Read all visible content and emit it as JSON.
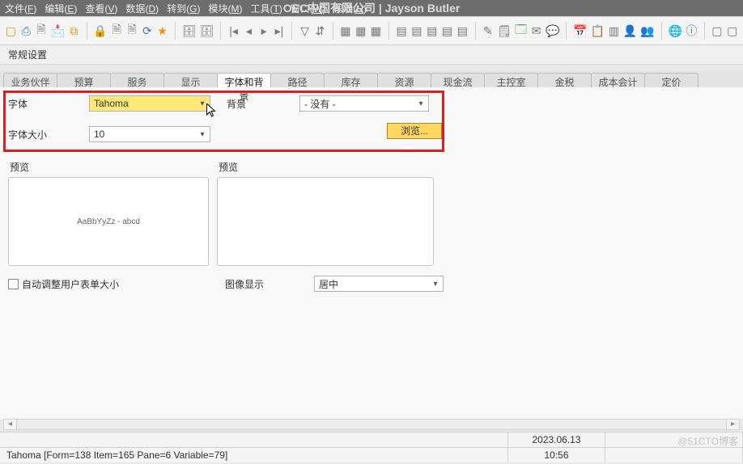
{
  "menubar": {
    "items": [
      {
        "label": "文件",
        "accel": "F"
      },
      {
        "label": "编辑",
        "accel": "E"
      },
      {
        "label": "查看",
        "accel": "V"
      },
      {
        "label": "数据",
        "accel": "D"
      },
      {
        "label": "转到",
        "accel": "G"
      },
      {
        "label": "模块",
        "accel": "M"
      },
      {
        "label": "工具",
        "accel": "T"
      },
      {
        "label": "窗口",
        "accel": "W"
      },
      {
        "label": "帮助",
        "accel": "H"
      }
    ],
    "title": "OEC中国有限公司   |   Jayson  Butler"
  },
  "panel_header": "常规设置",
  "tabs": [
    "业务伙伴",
    "预算",
    "服务",
    "显示",
    "字体和背景",
    "路径",
    "库存",
    "资源",
    "现金流",
    "主控室",
    "金税",
    "成本会计",
    "定价"
  ],
  "active_tab_index": 4,
  "form": {
    "font_label": "字体",
    "font_value": "Tahoma",
    "background_label": "背景",
    "background_value": "- 没有 -",
    "browse_label": "浏览...",
    "fontsize_label": "字体大小",
    "fontsize_value": "10",
    "preview_label_1": "预览",
    "preview_label_2": "预览",
    "preview_sample": "AaBbYyZz - abcd",
    "auto_resize_label": "自动调整用户表单大小",
    "image_display_label": "图像显示",
    "image_display_value": "居中"
  },
  "status": {
    "date": "2023.06.13",
    "time": "10:56",
    "info": "Tahoma [Form=138 Item=165 Pane=6 Variable=79]"
  },
  "watermark": "@51CTO博客",
  "icons": {
    "caret": "▾",
    "left": "◂",
    "right": "▸"
  }
}
